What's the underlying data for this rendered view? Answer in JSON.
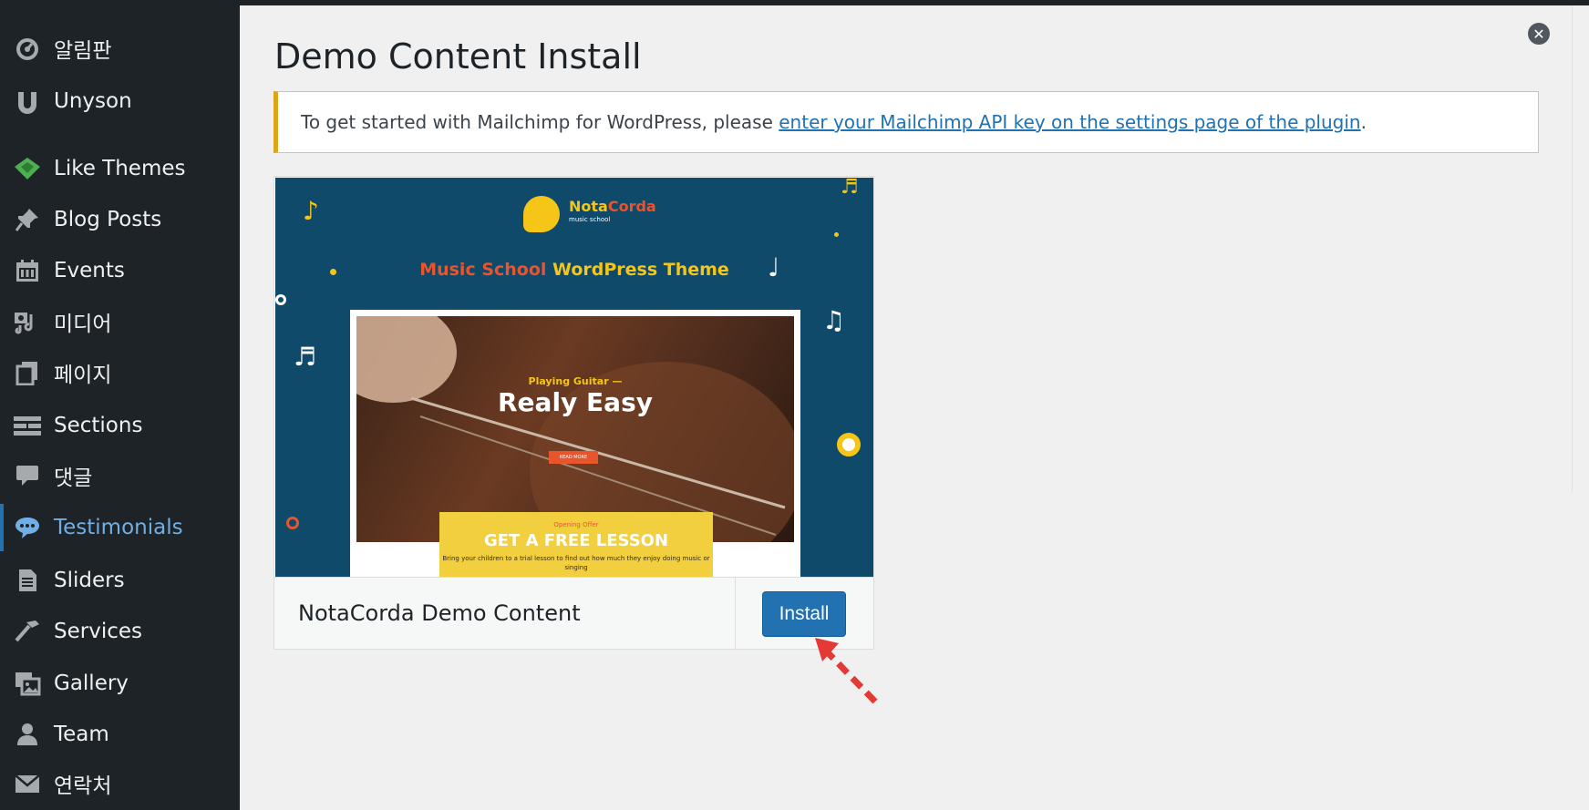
{
  "sidebar": {
    "items": [
      {
        "label": "알림판",
        "icon": "dashboard-icon"
      },
      {
        "label": "Unyson",
        "icon": "unyson-icon"
      },
      {
        "label": "Like Themes",
        "icon": "like-themes-icon"
      },
      {
        "label": "Blog Posts",
        "icon": "pin-icon"
      },
      {
        "label": "Events",
        "icon": "calendar-icon"
      },
      {
        "label": "미디어",
        "icon": "media-icon"
      },
      {
        "label": "페이지",
        "icon": "pages-icon"
      },
      {
        "label": "Sections",
        "icon": "sections-icon"
      },
      {
        "label": "댓글",
        "icon": "comment-icon"
      },
      {
        "label": "Testimonials",
        "icon": "testimonial-icon",
        "active": true
      },
      {
        "label": "Sliders",
        "icon": "document-icon"
      },
      {
        "label": "Services",
        "icon": "hammer-icon"
      },
      {
        "label": "Gallery",
        "icon": "gallery-icon"
      },
      {
        "label": "Team",
        "icon": "user-icon"
      },
      {
        "label": "연락처",
        "icon": "mail-icon"
      }
    ]
  },
  "main": {
    "title": "Demo Content Install",
    "notice": {
      "prefix": "To get started with Mailchimp for WordPress, please ",
      "link": "enter your Mailchimp API key on the settings page of the plugin",
      "suffix": "."
    },
    "demo": {
      "name": "NotaCorda Demo Content",
      "install_label": "Install",
      "preview": {
        "logo_a": "Nota",
        "logo_b": "Corda",
        "logo_sub": "music school",
        "headline_a": "Music School",
        "headline_b": " WordPress Theme",
        "hero_small": "Playing Guitar —",
        "hero_big": "Realy Easy",
        "hero_btn": "READ MORE",
        "offer_small": "Opening Offer",
        "offer_big": "GET A FREE LESSON",
        "offer_text": "Bring your children to a trial lesson to find out how much they enjoy doing music or singing"
      }
    }
  },
  "colors": {
    "sidebar_bg": "#1d2327",
    "accent": "#2271b1",
    "notice_border": "#dba617",
    "preview_bg": "#0f4a6b",
    "brand_yellow": "#f5c518",
    "brand_orange": "#e8542c",
    "arrow": "#e53935"
  }
}
